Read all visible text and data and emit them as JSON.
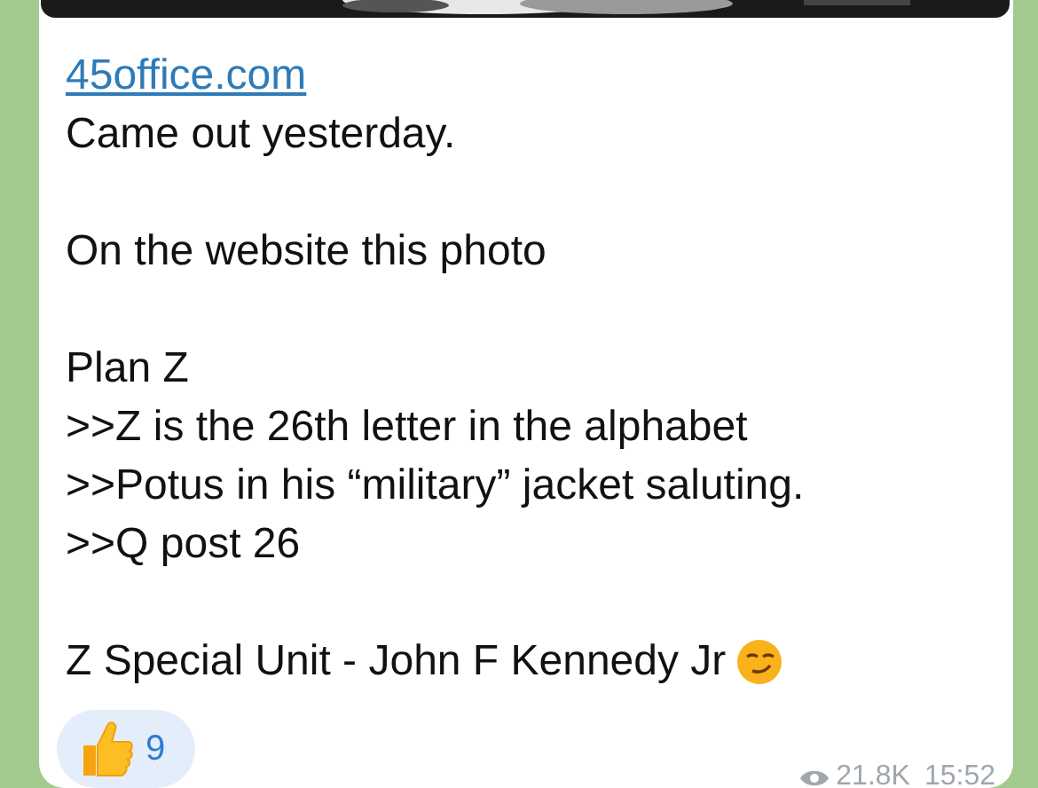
{
  "message": {
    "link": "45office.com",
    "paragraphs": [
      [
        "Came out yesterday."
      ],
      [
        "On the website this photo"
      ],
      [
        "Plan Z",
        ">>Z is the 26th letter in the alphabet",
        ">>Potus in his “military” jacket saluting.",
        ">>Q post 26"
      ],
      [
        "Z Special Unit - John F Kennedy Jr"
      ]
    ],
    "reaction": {
      "count": "9"
    },
    "views": "21.8K",
    "time": "15:52"
  }
}
